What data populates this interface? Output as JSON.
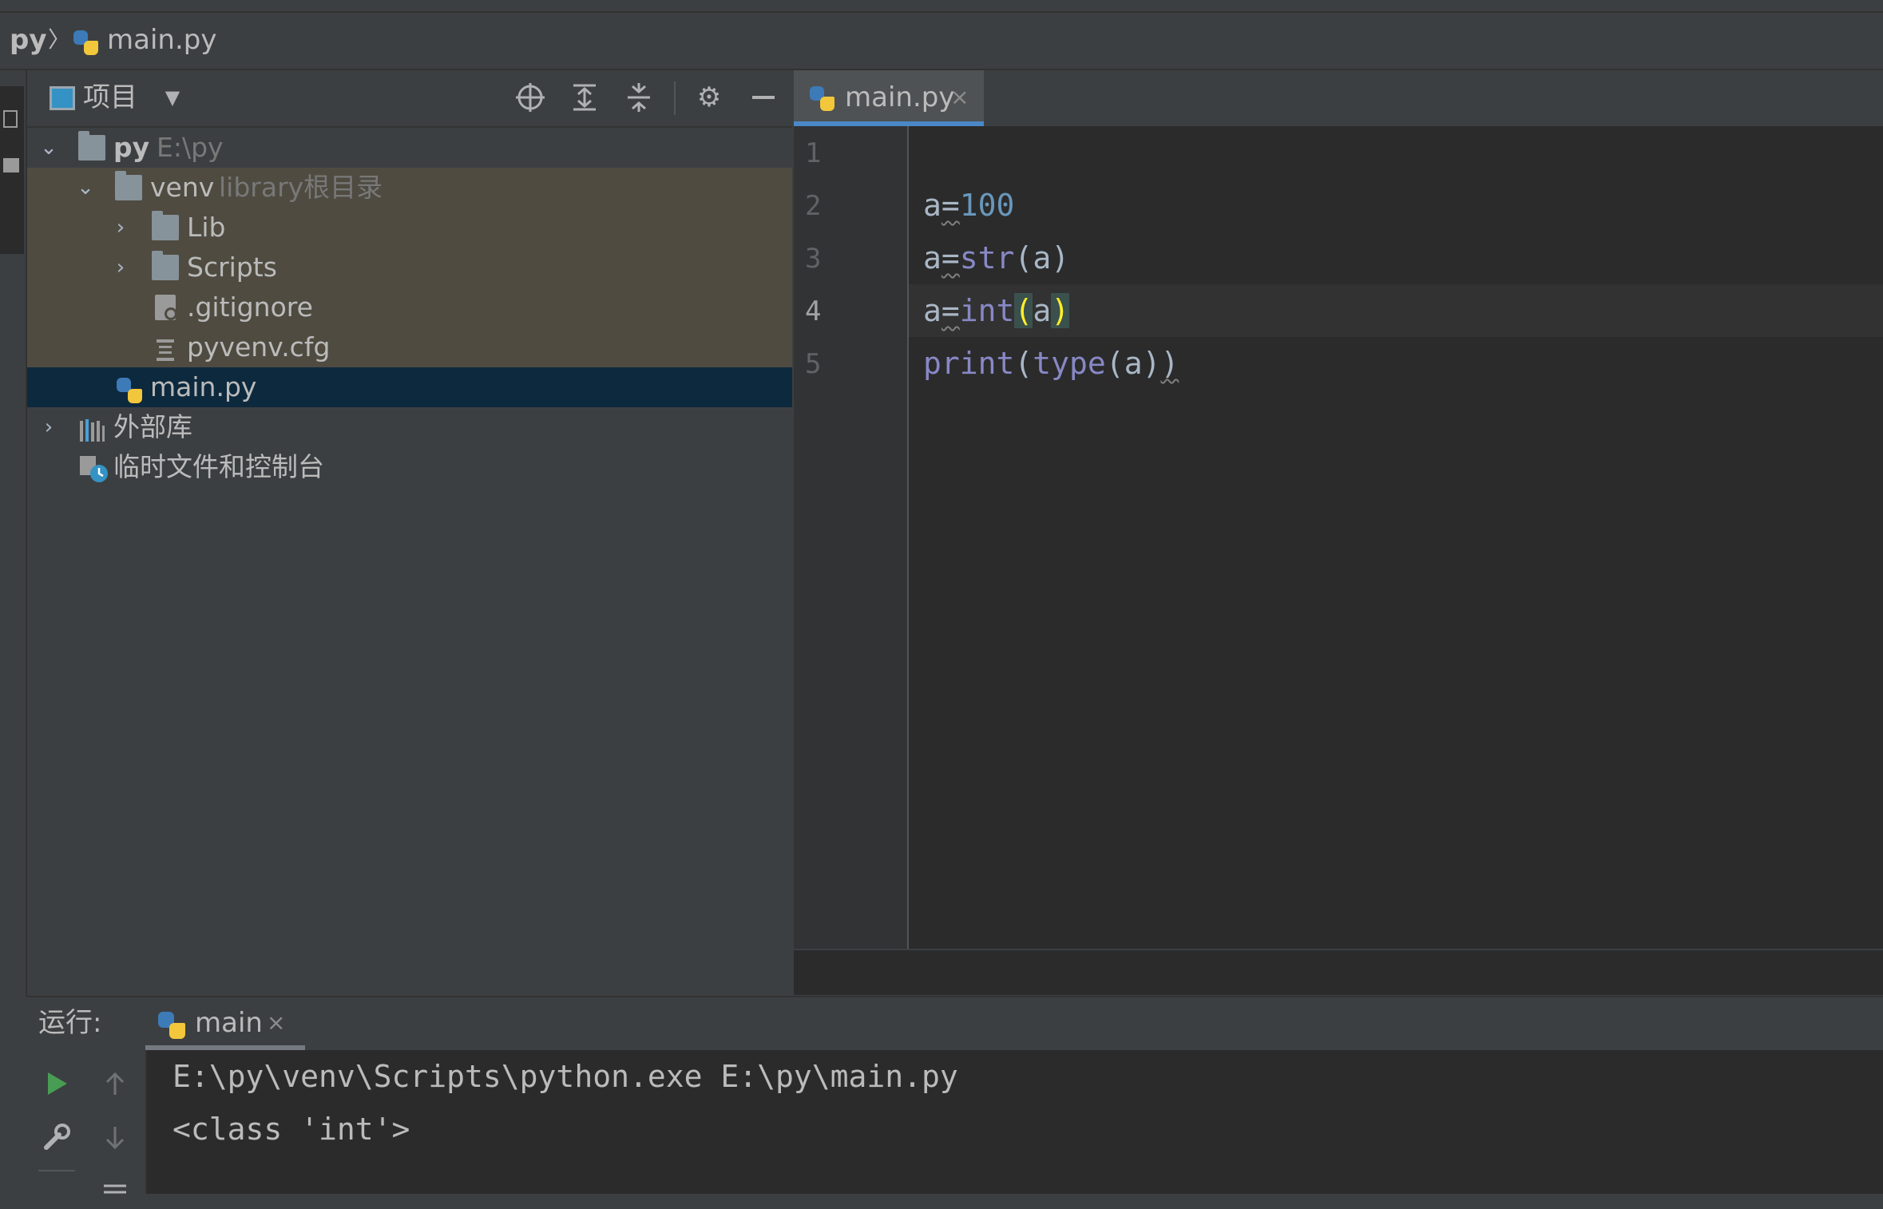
{
  "navbar": {
    "project": "py",
    "separator": "〉",
    "file": "main.py"
  },
  "project_panel": {
    "title": "项目",
    "icons": [
      "view-mode-icon",
      "dropdown-arrow-icon",
      "locate-icon",
      "expand-all-icon",
      "collapse-all-icon",
      "gear-icon",
      "minimize-icon"
    ],
    "tree": {
      "root": {
        "name": "py",
        "hint": "E:\\py"
      },
      "venv": {
        "name": "venv",
        "hint": "library根目录"
      },
      "lib": {
        "name": "Lib"
      },
      "scripts": {
        "name": "Scripts"
      },
      "gitignore": {
        "name": ".gitignore"
      },
      "pyvenv": {
        "name": "pyvenv.cfg"
      },
      "main": {
        "name": "main.py"
      },
      "external": {
        "name": "外部库"
      },
      "scratches": {
        "name": "临时文件和控制台"
      }
    }
  },
  "editor": {
    "tab_label": "main.py",
    "tab_close": "×",
    "line_numbers": [
      "1",
      "2",
      "3",
      "4",
      "5"
    ],
    "lines": {
      "l2": {
        "var": "a",
        "eq": "=",
        "value": "100"
      },
      "l3": {
        "var": "a",
        "eq": "=",
        "func": "str",
        "open": "(",
        "arg": "a",
        "close": ")"
      },
      "l4": {
        "var": "a",
        "eq": "=",
        "func": "int",
        "open": "(",
        "arg": "a",
        "close": ")"
      },
      "l5": {
        "func": "print",
        "open": "(",
        "inner_func": "type",
        "inner_open": "(",
        "arg": "a",
        "inner_close": ")",
        "close": ")"
      }
    }
  },
  "run_panel": {
    "label": "运行:",
    "tab_label": "main",
    "tab_close": "×",
    "output": [
      "E:\\py\\venv\\Scripts\\python.exe E:\\py\\main.py",
      "<class 'int'>"
    ]
  },
  "colors": {
    "background": "#3c3f41",
    "editor_bg": "#2b2b2b",
    "selected_row": "#0d293e",
    "excluded_row": "#4f4b41",
    "number": "#6897bb",
    "builtin": "#8888c6",
    "brace_match": "#ffef28",
    "tab_accent": "#4a88c7",
    "run_green": "#499c54"
  }
}
